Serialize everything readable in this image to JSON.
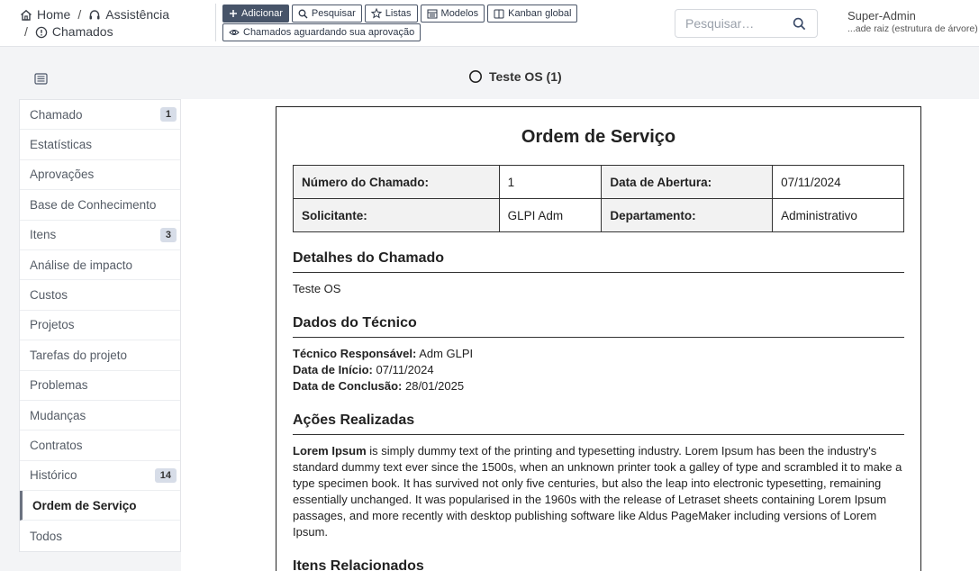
{
  "breadcrumb": {
    "home": "Home",
    "separator": "/",
    "assistance": "Assistência",
    "tickets": "Chamados"
  },
  "toolbar": {
    "add": "Adicionar",
    "search": "Pesquisar",
    "lists": "Listas",
    "templates": "Modelos",
    "kanban": "Kanban global",
    "awaiting": "Chamados aguardando sua aprovação"
  },
  "search": {
    "placeholder": "Pesquisar…"
  },
  "user": {
    "name": "Super-Admin",
    "entity": "...ade raiz (estrutura de árvore)"
  },
  "ticket": {
    "title": "Teste OS (1)"
  },
  "sidebar": {
    "items": [
      {
        "label": "Chamado",
        "badge": "1"
      },
      {
        "label": "Estatísticas",
        "badge": ""
      },
      {
        "label": "Aprovações",
        "badge": ""
      },
      {
        "label": "Base de Conhecimento",
        "badge": ""
      },
      {
        "label": "Itens",
        "badge": "3"
      },
      {
        "label": "Análise de impacto",
        "badge": ""
      },
      {
        "label": "Custos",
        "badge": ""
      },
      {
        "label": "Projetos",
        "badge": ""
      },
      {
        "label": "Tarefas do projeto",
        "badge": ""
      },
      {
        "label": "Problemas",
        "badge": ""
      },
      {
        "label": "Mudanças",
        "badge": ""
      },
      {
        "label": "Contratos",
        "badge": ""
      },
      {
        "label": "Histórico",
        "badge": "14"
      },
      {
        "label": "Ordem de Serviço",
        "badge": ""
      },
      {
        "label": "Todos",
        "badge": ""
      }
    ]
  },
  "doc": {
    "title": "Ordem de Serviço",
    "table": {
      "ticket_number_label": "Número do Chamado:",
      "ticket_number": "1",
      "open_date_label": "Data de Abertura:",
      "open_date": "07/11/2024",
      "requester_label": "Solicitante:",
      "requester": "GLPI Adm",
      "department_label": "Departamento:",
      "department": "Administrativo"
    },
    "details": {
      "title": "Detalhes do Chamado",
      "text": "Teste OS"
    },
    "technician": {
      "title": "Dados do Técnico",
      "responsible_label": "Técnico Responsável:",
      "responsible": "Adm GLPI",
      "start_label": "Data de Início:",
      "start": "07/11/2024",
      "end_label": "Data de Conclusão:",
      "end": "28/01/2025"
    },
    "actions": {
      "title": "Ações Realizadas",
      "bold": "Lorem Ipsum",
      "text": "is simply dummy text of the printing and typesetting industry. Lorem Ipsum has been the industry's standard dummy text ever since the 1500s, when an unknown printer took a galley of type and scrambled it to make a type specimen book. It has survived not only five centuries, but also the leap into electronic typesetting, remaining essentially unchanged. It was popularised in the 1960s with the release of Letraset sheets containing Lorem Ipsum passages, and more recently with desktop publishing software like Aldus PageMaker including versions of Lorem Ipsum."
    },
    "related": {
      "title": "Itens Relacionados"
    }
  },
  "icons": {
    "home": "home-icon",
    "assistance": "headset-icon",
    "tickets": "alert-circle-icon",
    "add": "plus-icon",
    "search": "search-icon",
    "lists": "star-icon",
    "templates": "template-icon",
    "kanban": "columns-icon",
    "awaiting": "eye-icon",
    "sidebar_toggle": "list-icon",
    "ticket_status": "circle-status-icon"
  },
  "colors": {
    "primary_button": "#475469",
    "badge": "#d7dde8",
    "background": "#f3f4f6"
  }
}
